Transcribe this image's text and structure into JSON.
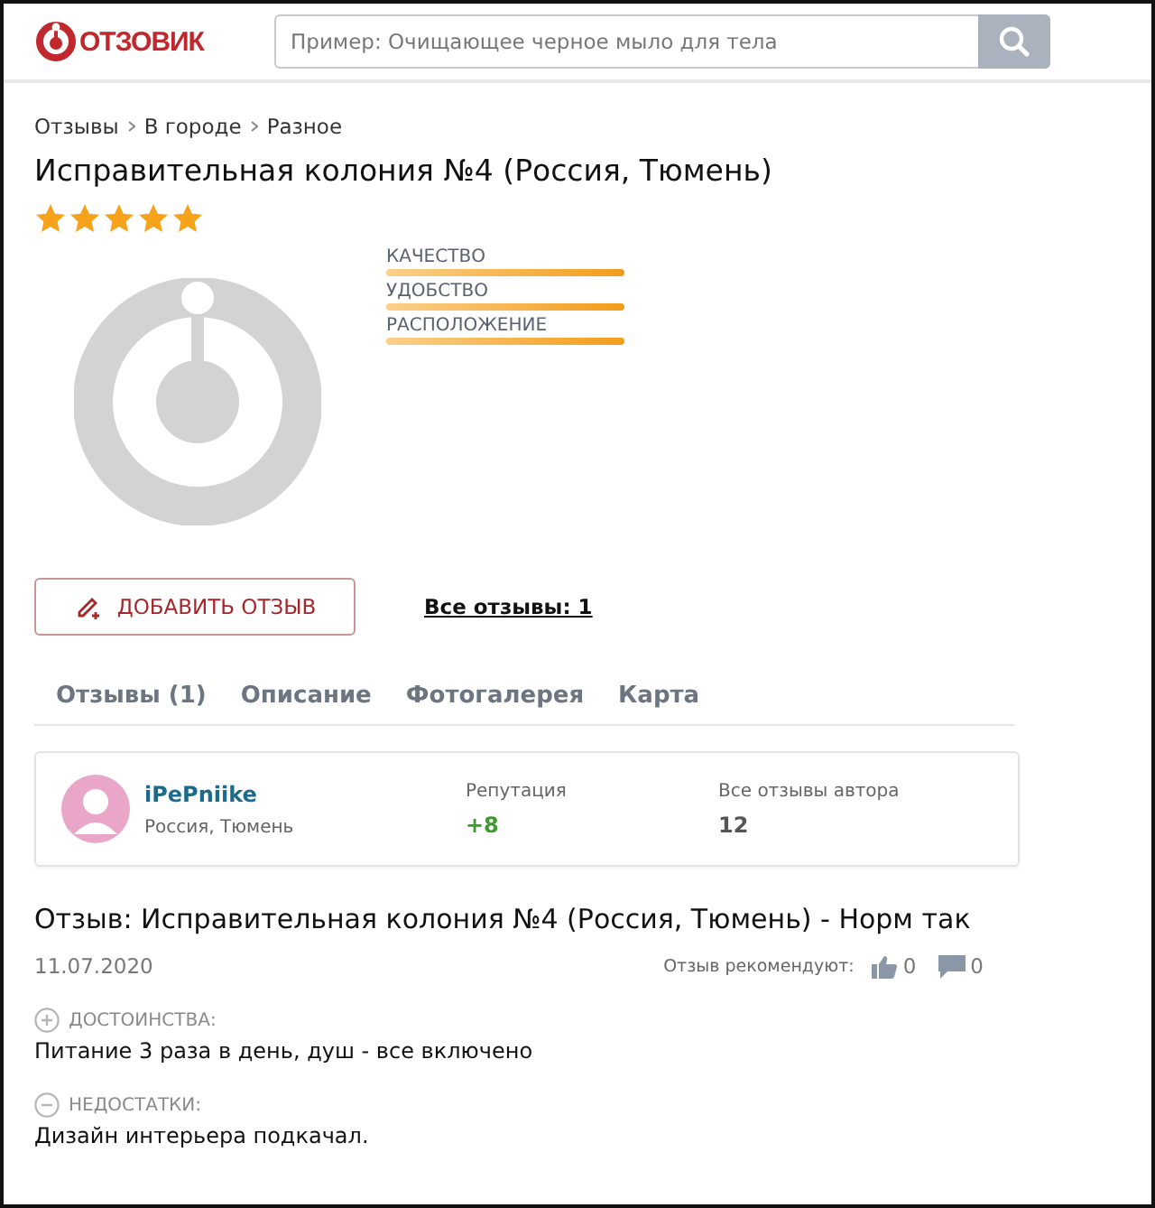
{
  "header": {
    "logo": "ОТЗОВИК",
    "search": {
      "placeholder": "Пример: Очищающее черное мыло для тела"
    }
  },
  "breadcrumbs": [
    "Отзывы",
    "В городе",
    "Разное"
  ],
  "title": "Исправительная колония №4 (Россия, Тюмень)",
  "rating": {
    "stars": 5
  },
  "criteria": [
    {
      "label": "КАЧЕСТВО",
      "level": 1
    },
    {
      "label": "УДОБСТВО",
      "level": 1
    },
    {
      "label": "РАСПОЛОЖЕНИЕ",
      "level": 1
    }
  ],
  "actions": {
    "add_review": "ДОБАВИТЬ ОТЗЫВ",
    "all_reviews": "Все отзывы: 1"
  },
  "tabs": [
    "Отзывы (1)",
    "Описание",
    "Фотогалерея",
    "Карта"
  ],
  "author": {
    "name": "iPePniike",
    "location": "Россия, Тюмень",
    "reputation_label": "Репутация",
    "reputation": "+8",
    "reviews_label": "Все отзывы автора",
    "reviews": "12"
  },
  "review": {
    "title": "Отзыв: Исправительная колония №4 (Россия, Тюмень) - Норм так",
    "date": "11.07.2020",
    "recommend_label": "Отзыв рекомендуют:",
    "likes": "0",
    "comments": "0",
    "sections": [
      {
        "kind": "plus",
        "label": "ДОСТОИНСТВА:",
        "text": "Питание 3 раза в день, душ - все включено"
      },
      {
        "kind": "minus",
        "label": "НЕДОСТАТКИ:",
        "text": "Дизайн интерьера подкачал."
      }
    ]
  }
}
